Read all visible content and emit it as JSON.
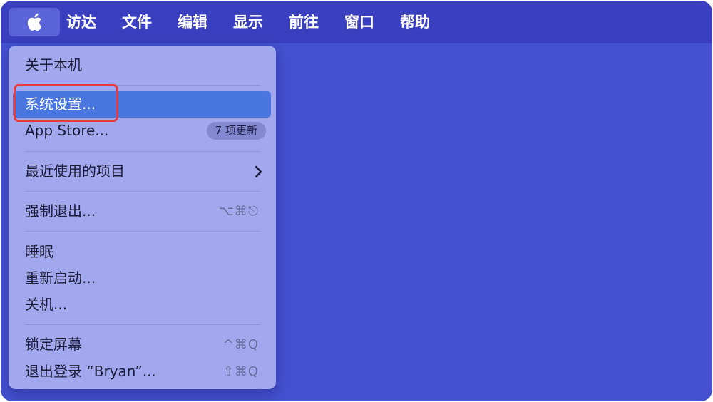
{
  "menubar": {
    "apple_icon": "apple-logo-icon",
    "titles": [
      "访达",
      "文件",
      "编辑",
      "显示",
      "前往",
      "窗口",
      "帮助"
    ]
  },
  "apple_menu": {
    "about": "关于本机",
    "system_settings": "系统设置...",
    "app_store": "App Store...",
    "app_store_badge": "7 项更新",
    "recent_items": "最近使用的项目",
    "force_quit": "强制退出...",
    "force_quit_shortcut": "⌥⌘⎋",
    "sleep": "睡眠",
    "restart": "重新启动...",
    "shutdown": "关机...",
    "lock_screen": "锁定屏幕",
    "lock_screen_shortcut": "^⌘Q",
    "logout": "退出登录 “Bryan”...",
    "logout_shortcut": "⇧⌘Q"
  },
  "colors": {
    "desktop": "#4551cf",
    "menubar": "#3a3fbf",
    "menu_bg": "#a1a8ee",
    "selected": "#4a77df",
    "highlight_box": "#e83a3e"
  }
}
